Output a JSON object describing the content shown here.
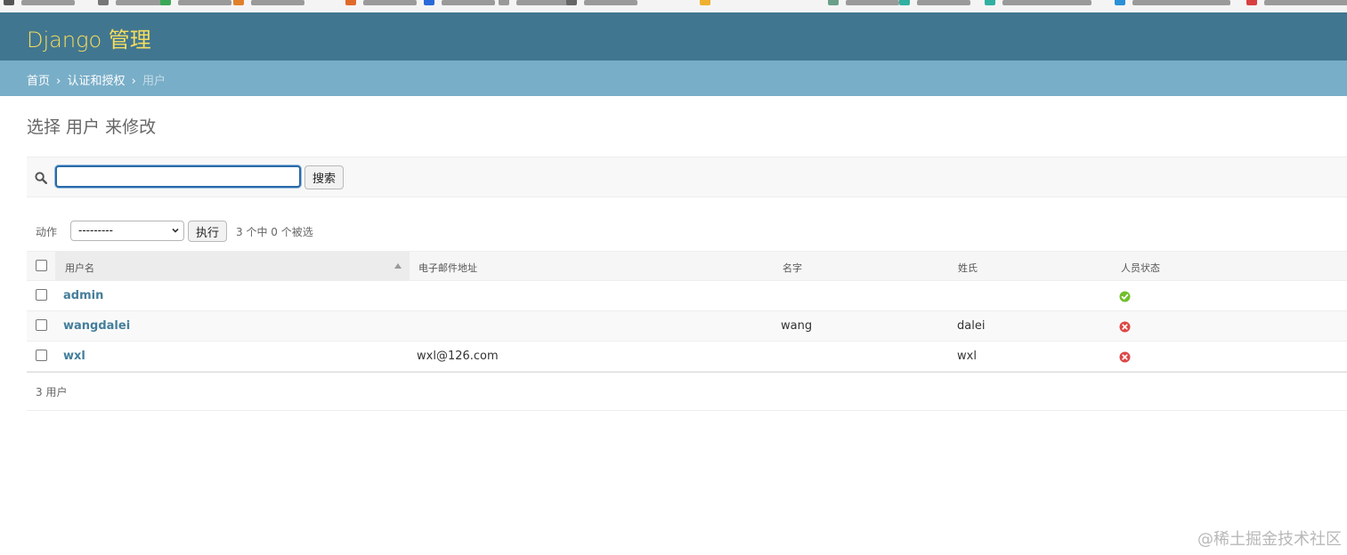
{
  "header": {
    "branding": "Django 管理"
  },
  "breadcrumbs": {
    "home": "首页",
    "app": "认证和授权",
    "current": "用户",
    "separator": "›"
  },
  "page": {
    "title": "选择 用户 来修改"
  },
  "search": {
    "value": "",
    "button_label": "搜索",
    "icon": "search-icon"
  },
  "actions": {
    "label": "动作",
    "selected": "---------",
    "go_label": "执行",
    "counter": "3 个中 0 个被选"
  },
  "table": {
    "columns": [
      "用户名",
      "电子邮件地址",
      "名字",
      "姓氏",
      "人员状态"
    ],
    "sorted_column": "用户名",
    "sort_direction": "ascending",
    "rows": [
      {
        "username": "admin",
        "email": "",
        "first_name": "",
        "last_name": "",
        "is_staff": true
      },
      {
        "username": "wangdalei",
        "email": "",
        "first_name": "wang",
        "last_name": "dalei",
        "is_staff": false
      },
      {
        "username": "wxl",
        "email": "wxl@126.com",
        "first_name": "",
        "last_name": "wxl",
        "is_staff": false
      }
    ]
  },
  "paginator": {
    "text": "3 用户"
  },
  "watermark": "@稀土掘金技术社区",
  "colors": {
    "header_bg": "#417690",
    "branding": "#f5dd5d",
    "breadcrumbs_bg": "#79aec8",
    "link": "#447e9b",
    "status_true": "#70bf2b",
    "status_false": "#dd4646"
  }
}
